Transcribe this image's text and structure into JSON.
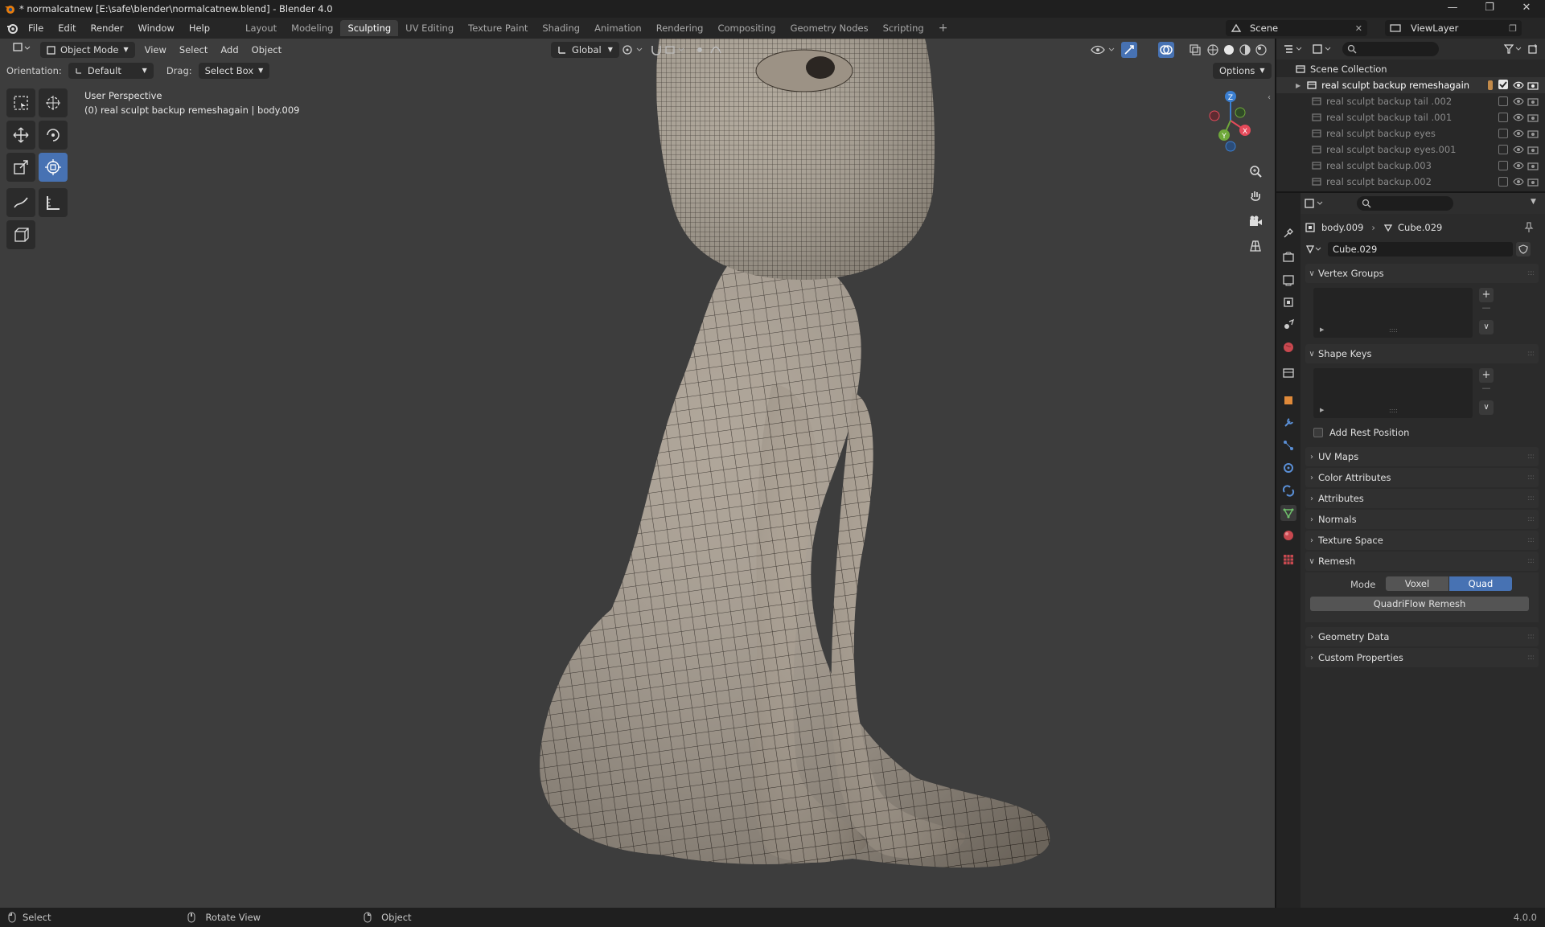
{
  "window": {
    "title": "* normalcatnew [E:\\safe\\blender\\normalcatnew.blend] - Blender 4.0",
    "minimize_icon": "minimize-icon",
    "maximize_icon": "restore-icon",
    "close_icon": "close-icon"
  },
  "menu": {
    "items": [
      "File",
      "Edit",
      "Render",
      "Window",
      "Help"
    ]
  },
  "workspaces": {
    "tabs": [
      "Layout",
      "Modeling",
      "Sculpting",
      "UV Editing",
      "Texture Paint",
      "Shading",
      "Animation",
      "Rendering",
      "Compositing",
      "Geometry Nodes",
      "Scripting"
    ],
    "active": "Sculpting",
    "add_label": "+"
  },
  "scene": {
    "name": "Scene",
    "view_layer": "ViewLayer"
  },
  "viewport_header": {
    "mode": "Object Mode",
    "menus": [
      "View",
      "Select",
      "Add",
      "Object"
    ],
    "transform_orientation": "Global",
    "options_label": "Options"
  },
  "tool_settings": {
    "orientation_label": "Orientation:",
    "orientation_value": "Default",
    "drag_label": "Drag:",
    "drag_value": "Select Box"
  },
  "viewport_overlay": {
    "perspective": "User Perspective",
    "object_info": "(0) real sculpt backup remeshagain | body.009"
  },
  "gizmo": {
    "z": "Z",
    "y": "Y",
    "x": "X"
  },
  "outliner": {
    "root": "Scene Collection",
    "items": [
      {
        "name": "real sculpt backup remeshagain",
        "active": true
      },
      {
        "name": "real sculpt backup tail .002",
        "active": false
      },
      {
        "name": "real sculpt backup tail .001",
        "active": false
      },
      {
        "name": "real sculpt backup eyes",
        "active": false
      },
      {
        "name": "real sculpt backup eyes.001",
        "active": false
      },
      {
        "name": "real sculpt backup.003",
        "active": false
      },
      {
        "name": "real sculpt backup.002",
        "active": false
      }
    ]
  },
  "properties": {
    "breadcrumb_object": "body.009",
    "breadcrumb_data": "Cube.029",
    "mesh_name": "Cube.029",
    "panels": {
      "vertex_groups": "Vertex Groups",
      "shape_keys": "Shape Keys",
      "add_rest_position": "Add Rest Position",
      "uv_maps": "UV Maps",
      "color_attributes": "Color Attributes",
      "attributes": "Attributes",
      "normals": "Normals",
      "texture_space": "Texture Space",
      "remesh": "Remesh",
      "geometry_data": "Geometry Data",
      "custom_properties": "Custom Properties"
    },
    "remesh": {
      "mode_label": "Mode",
      "voxel": "Voxel",
      "quad": "Quad",
      "active_mode": "Quad",
      "quadriflow_button": "QuadriFlow Remesh"
    }
  },
  "statusbar": {
    "select": "Select",
    "rotate_view": "Rotate View",
    "object": "Object",
    "version": "4.0.0"
  },
  "colors": {
    "accent": "#4772b3",
    "viewport_bg": "#3d3d3d",
    "mesh": "#a59a8c",
    "axis_x": "#e54a5a",
    "axis_y": "#6fa83a",
    "axis_z": "#3b7fd1"
  }
}
